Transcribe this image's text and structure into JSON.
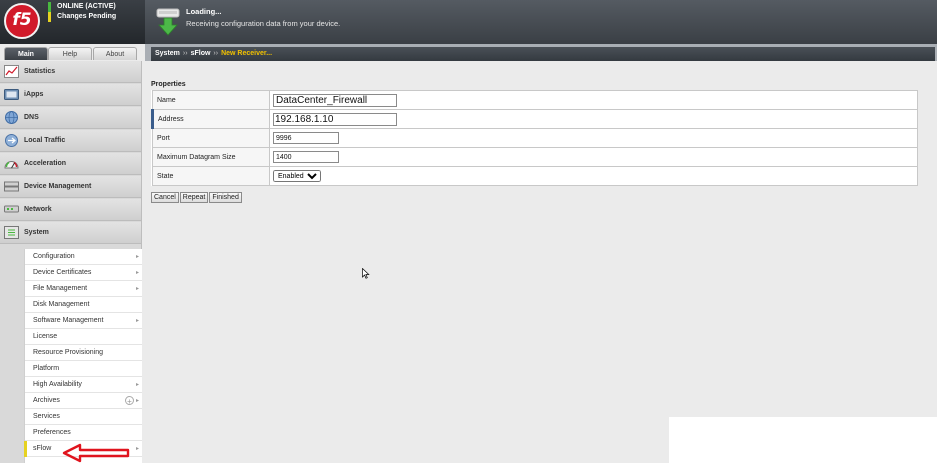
{
  "status": {
    "logo_text": "f5",
    "online": "ONLINE (ACTIVE)",
    "changes": "Changes Pending",
    "online_color": "#49b83f",
    "changes_color": "#e6d221"
  },
  "banner": {
    "title": "Loading...",
    "text": "Receiving configuration data from your device.",
    "icon": "download-arrow-icon"
  },
  "tabs": [
    {
      "label": "Main",
      "active": true
    },
    {
      "label": "Help",
      "active": false
    },
    {
      "label": "About",
      "active": false
    }
  ],
  "breadcrumb": {
    "items": [
      "System",
      "sFlow"
    ],
    "current": "New Receiver...",
    "separator": "››"
  },
  "nav": [
    {
      "label": "Statistics",
      "icon": "chart-icon"
    },
    {
      "label": "iApps",
      "icon": "iapps-icon"
    },
    {
      "label": "DNS",
      "icon": "globe-icon"
    },
    {
      "label": "Local Traffic",
      "icon": "traffic-icon"
    },
    {
      "label": "Acceleration",
      "icon": "gauge-icon"
    },
    {
      "label": "Device Management",
      "icon": "device-icon"
    },
    {
      "label": "Network",
      "icon": "network-icon"
    },
    {
      "label": "System",
      "icon": "system-icon"
    }
  ],
  "submenu": [
    {
      "label": "Configuration",
      "arrow": true
    },
    {
      "label": "Device Certificates",
      "arrow": true
    },
    {
      "label": "File Management",
      "arrow": true
    },
    {
      "label": "Disk Management",
      "arrow": false
    },
    {
      "label": "Software Management",
      "arrow": true
    },
    {
      "label": "License",
      "arrow": false
    },
    {
      "label": "Resource Provisioning",
      "arrow": false
    },
    {
      "label": "Platform",
      "arrow": false
    },
    {
      "label": "High Availability",
      "arrow": true
    },
    {
      "label": "Archives",
      "arrow": true,
      "plus": true
    },
    {
      "label": "Services",
      "arrow": false
    },
    {
      "label": "Preferences",
      "arrow": false
    },
    {
      "label": "sFlow",
      "arrow": true,
      "active": true
    }
  ],
  "properties": {
    "section_title": "Properties",
    "name_label": "Name",
    "name_value": "DataCenter_Firewall",
    "address_label": "Address",
    "address_value": "192.168.1.10",
    "port_label": "Port",
    "port_value": "9996",
    "dgram_label": "Maximum Datagram Size",
    "dgram_value": "1400",
    "state_label": "State",
    "state_value": "Enabled"
  },
  "buttons": {
    "cancel": "Cancel",
    "repeat": "Repeat",
    "finished": "Finished"
  }
}
